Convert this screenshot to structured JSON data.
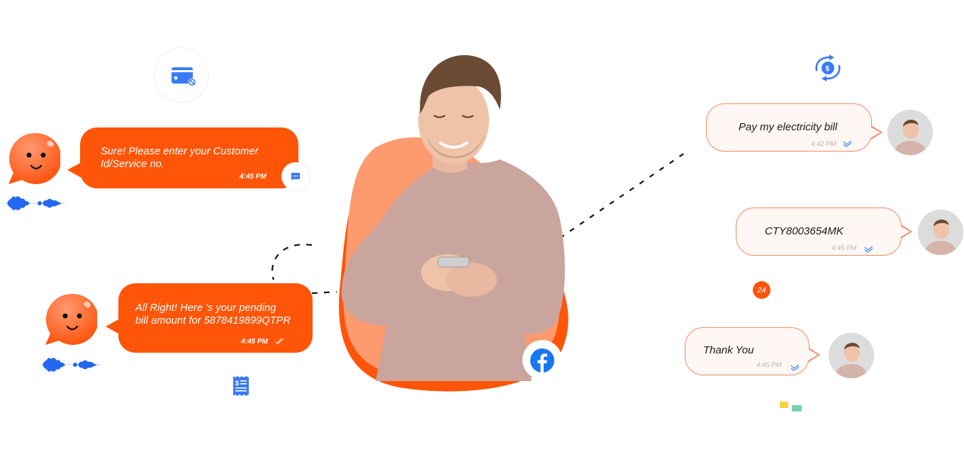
{
  "conversation": {
    "bot_messages": [
      {
        "text_line1": "Sure! Please enter your Customer",
        "text_line2": "Id/Service no.",
        "time": "4:45 PM"
      },
      {
        "text_line1": "All Right! Here 's your pending",
        "text_line2": "bill amount for 5878419899QTPR",
        "time": "4:45 PM",
        "status": "read"
      }
    ],
    "user_messages": [
      {
        "text": "Pay my electricity bill",
        "time": "4:42 PM",
        "status": "read"
      },
      {
        "text": "CTY8003654MK",
        "time": "4:45 PM",
        "status": "read"
      },
      {
        "text": "Thank You",
        "time": "4:45 PM",
        "status": "read"
      }
    ]
  },
  "badges": {
    "count_badge": "24",
    "dollar_symbol": "$"
  },
  "icons": {
    "card_blocked": "credit-card-blocked-icon",
    "typing": "typing-chat-icon",
    "currency_exchange": "currency-exchange-icon",
    "receipt": "bill-receipt-icon",
    "facebook": "facebook-icon",
    "voice_wave": "voice-wave-icon",
    "bot": "smiley-bot-icon",
    "double_check": "double-check-icon"
  },
  "colors": {
    "brand_orange": "#fe5508",
    "blob_light_orange": "#fd9a6e",
    "accent_blue": "#3a7bf5",
    "user_bubble_bg": "#fff7f3",
    "user_bubble_border": "#f08b66",
    "facebook_blue": "#1877f2"
  }
}
